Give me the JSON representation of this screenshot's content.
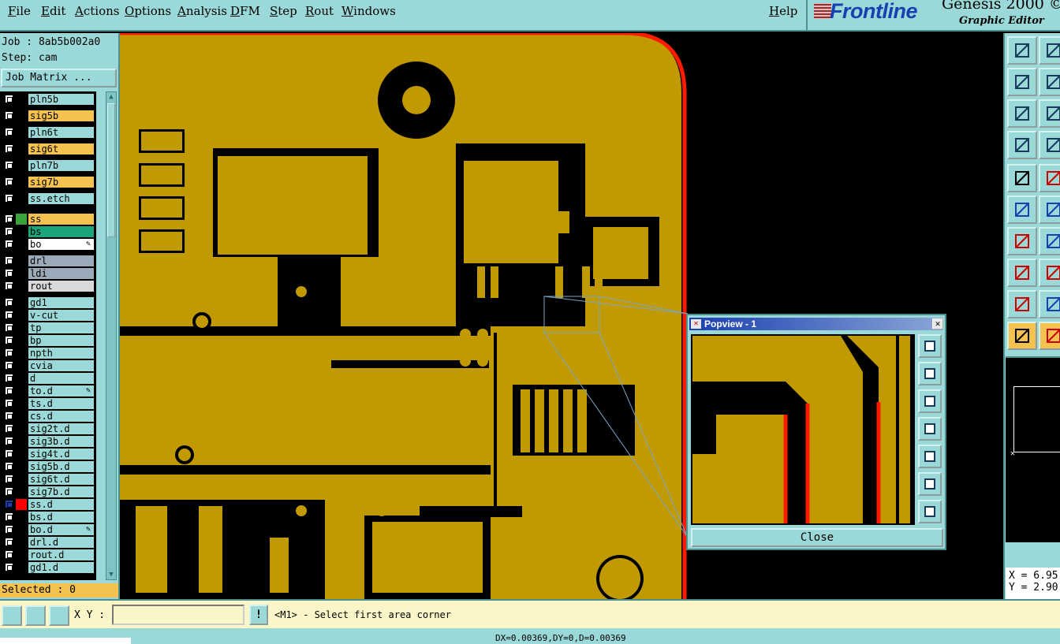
{
  "menubar": {
    "items": [
      "File",
      "Edit",
      "Actions",
      "Options",
      "Analysis",
      "DFM",
      "Step",
      "Rout",
      "Windows"
    ],
    "help": "Help"
  },
  "brand": {
    "logo": "Frontline",
    "title": "Genesis 2000 ©",
    "subtitle": "Graphic Editor"
  },
  "left_panel": {
    "job": "Job : 8ab5b002a0",
    "step": "Step: cam",
    "job_matrix": "Job Matrix ...",
    "layers": [
      {
        "name": "pln5b",
        "color": "#9bd8d8",
        "swatch": "#000000"
      },
      {
        "name": "sig5b",
        "color": "#f5c24f",
        "swatch": "#000000"
      },
      {
        "name": "pln6t",
        "color": "#9bd8d8",
        "swatch": "#000000"
      },
      {
        "name": "sig6t",
        "color": "#f5c24f",
        "swatch": "#000000"
      },
      {
        "name": "pln7b",
        "color": "#9bd8d8",
        "swatch": "#000000"
      },
      {
        "name": "sig7b",
        "color": "#f5c24f",
        "swatch": "#000000"
      },
      {
        "name": "ss.etch",
        "color": "#9bd8d8",
        "swatch": "#000000"
      },
      {
        "name": "ss",
        "color": "#f5c24f",
        "swatch": "#3aa43a"
      },
      {
        "name": "bs",
        "color": "#1aa67a",
        "swatch": "#000000"
      },
      {
        "name": "bo",
        "color": "#ffffff",
        "swatch": "#000000",
        "edit": true
      },
      {
        "name": "drl",
        "color": "#9aaab8",
        "swatch": "#000000"
      },
      {
        "name": "ldi",
        "color": "#9aaab8",
        "swatch": "#000000"
      },
      {
        "name": "rout",
        "color": "#d9d9d9",
        "swatch": "#000000"
      },
      {
        "name": "gd1",
        "color": "#9bd8d8",
        "swatch": "#000000"
      },
      {
        "name": "v-cut",
        "color": "#9bd8d8",
        "swatch": "#000000"
      },
      {
        "name": "tp",
        "color": "#9bd8d8",
        "swatch": "#000000"
      },
      {
        "name": "bp",
        "color": "#9bd8d8",
        "swatch": "#000000"
      },
      {
        "name": "npth",
        "color": "#9bd8d8",
        "swatch": "#000000"
      },
      {
        "name": "cvia",
        "color": "#9bd8d8",
        "swatch": "#000000"
      },
      {
        "name": "d",
        "color": "#9bd8d8",
        "swatch": "#000000"
      },
      {
        "name": "to.d",
        "color": "#9bd8d8",
        "swatch": "#000000",
        "edit": true
      },
      {
        "name": "ts.d",
        "color": "#9bd8d8",
        "swatch": "#000000"
      },
      {
        "name": "cs.d",
        "color": "#9bd8d8",
        "swatch": "#000000"
      },
      {
        "name": "sig2t.d",
        "color": "#9bd8d8",
        "swatch": "#000000"
      },
      {
        "name": "sig3b.d",
        "color": "#9bd8d8",
        "swatch": "#000000"
      },
      {
        "name": "sig4t.d",
        "color": "#9bd8d8",
        "swatch": "#000000"
      },
      {
        "name": "sig5b.d",
        "color": "#9bd8d8",
        "swatch": "#000000"
      },
      {
        "name": "sig6t.d",
        "color": "#9bd8d8",
        "swatch": "#000000"
      },
      {
        "name": "sig7b.d",
        "color": "#9bd8d8",
        "swatch": "#000000"
      },
      {
        "name": "ss.d",
        "color": "#9bd8d8",
        "swatch": "#ff0000",
        "active": true
      },
      {
        "name": "bs.d",
        "color": "#9bd8d8",
        "swatch": "#000000"
      },
      {
        "name": "bo.d",
        "color": "#9bd8d8",
        "swatch": "#000000",
        "edit": true
      },
      {
        "name": "drl.d",
        "color": "#9bd8d8",
        "swatch": "#000000"
      },
      {
        "name": "rout.d",
        "color": "#9bd8d8",
        "swatch": "#000000"
      },
      {
        "name": "gd1.d",
        "color": "#9bd8d8",
        "swatch": "#000000"
      }
    ],
    "selected": "Selected : 0"
  },
  "popview": {
    "title": "Popview - 1",
    "close_label": "Close",
    "tool_icons": [
      "zoom-fit-icon",
      "pan-up-icon",
      "pan-down-icon",
      "pan-left-icon",
      "pan-right-icon",
      "zoom-in-icon",
      "zoom-out-icon"
    ]
  },
  "right_toolbar": {
    "icons": [
      "pan-up-icon",
      "pan-down-icon",
      "pan-left-icon",
      "pan-right-icon",
      "zoom-in-icon",
      "zoom-out-icon",
      "settings-icon",
      "grid-icon",
      "snap-icon",
      "draw-rect-icon",
      "nodes-icon",
      "delete-icon",
      "line-icon",
      "line-alt-icon",
      "move-icon",
      "measure-icon",
      "triangle-icon",
      "triangle-alt-icon",
      "pointer-icon",
      "pointer-select-icon"
    ],
    "coord_x": "X = 6.95",
    "coord_y": "Y = 2.90"
  },
  "bottom_bar": {
    "xy_label": "X Y :",
    "xy_value": "",
    "warning": "!",
    "prompt": "<M1> - Select first area corner",
    "status": "DX=0.00369,DY=0,D=0.00369"
  },
  "colors": {
    "copper": "#c09a00",
    "panel": "#9bd8d8",
    "outline": "#ff0000"
  }
}
